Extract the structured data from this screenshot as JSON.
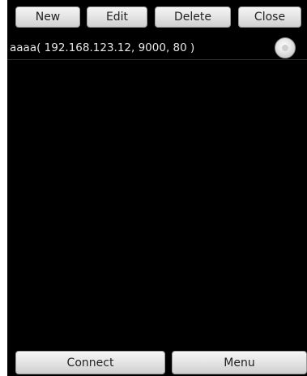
{
  "toolbar": {
    "new_label": "New",
    "edit_label": "Edit",
    "delete_label": "Delete",
    "close_label": "Close"
  },
  "connections": [
    {
      "label": "aaaa( 192.168.123.12, 9000, 80 )",
      "selected": false
    }
  ],
  "bottom_bar": {
    "connect_label": "Connect",
    "menu_label": "Menu"
  }
}
